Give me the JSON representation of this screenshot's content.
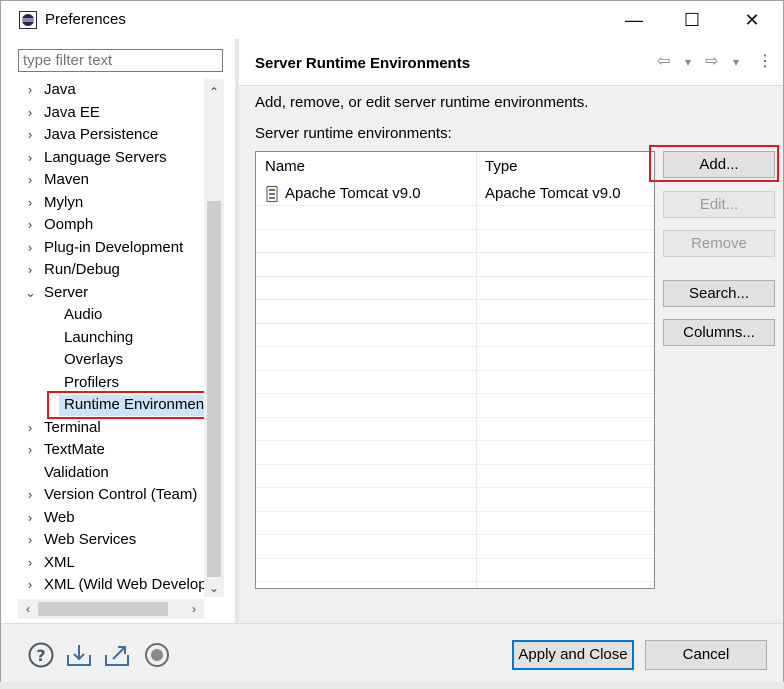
{
  "window": {
    "title": "Preferences",
    "minimize": "—",
    "maximize": "☐",
    "close": "✕"
  },
  "filter": {
    "placeholder": "type filter text"
  },
  "tree": [
    {
      "label": "Java",
      "chev": "›",
      "depth": 0
    },
    {
      "label": "Java EE",
      "chev": "›",
      "depth": 0
    },
    {
      "label": "Java Persistence",
      "chev": "›",
      "depth": 0
    },
    {
      "label": "Language Servers",
      "chev": "›",
      "depth": 0
    },
    {
      "label": "Maven",
      "chev": "›",
      "depth": 0
    },
    {
      "label": "Mylyn",
      "chev": "›",
      "depth": 0
    },
    {
      "label": "Oomph",
      "chev": "›",
      "depth": 0
    },
    {
      "label": "Plug-in Development",
      "chev": "›",
      "depth": 0
    },
    {
      "label": "Run/Debug",
      "chev": "›",
      "depth": 0
    },
    {
      "label": "Server",
      "chev": "⌄",
      "depth": 0
    },
    {
      "label": "Audio",
      "chev": "",
      "depth": 1
    },
    {
      "label": "Launching",
      "chev": "",
      "depth": 1
    },
    {
      "label": "Overlays",
      "chev": "",
      "depth": 1
    },
    {
      "label": "Profilers",
      "chev": "",
      "depth": 1
    },
    {
      "label": "Runtime Environmen",
      "chev": "",
      "depth": 1,
      "selected": true
    },
    {
      "label": "Terminal",
      "chev": "›",
      "depth": 0
    },
    {
      "label": "TextMate",
      "chev": "›",
      "depth": 0
    },
    {
      "label": "Validation",
      "chev": "",
      "depth": 0
    },
    {
      "label": "Version Control (Team)",
      "chev": "›",
      "depth": 0
    },
    {
      "label": "Web",
      "chev": "›",
      "depth": 0
    },
    {
      "label": "Web Services",
      "chev": "›",
      "depth": 0
    },
    {
      "label": "XML",
      "chev": "›",
      "depth": 0
    },
    {
      "label": "XML (Wild Web Develop",
      "chev": "›",
      "depth": 0
    }
  ],
  "scroll": {
    "up": "⌃",
    "down": "⌄",
    "left": "‹",
    "right": "›"
  },
  "page": {
    "title": "Server Runtime Environments",
    "description": "Add, remove, or edit server runtime environments.",
    "list_label": "Server runtime environments:",
    "nav": {
      "back": "⇦",
      "back_menu": "▾",
      "forward": "⇨",
      "forward_menu": "▾",
      "more": "⋮"
    }
  },
  "table": {
    "columns": [
      "Name",
      "Type"
    ],
    "rows": [
      {
        "name": "Apache Tomcat v9.0",
        "type": "Apache Tomcat v9.0"
      }
    ]
  },
  "buttons": {
    "add": "Add...",
    "edit": "Edit...",
    "remove": "Remove",
    "search": "Search...",
    "columns": "Columns..."
  },
  "footer": {
    "apply_close": "Apply and Close",
    "cancel": "Cancel"
  },
  "colors": {
    "highlight_red": "#d42020",
    "selection": "#cce4f7",
    "primary_border": "#0078d7"
  }
}
